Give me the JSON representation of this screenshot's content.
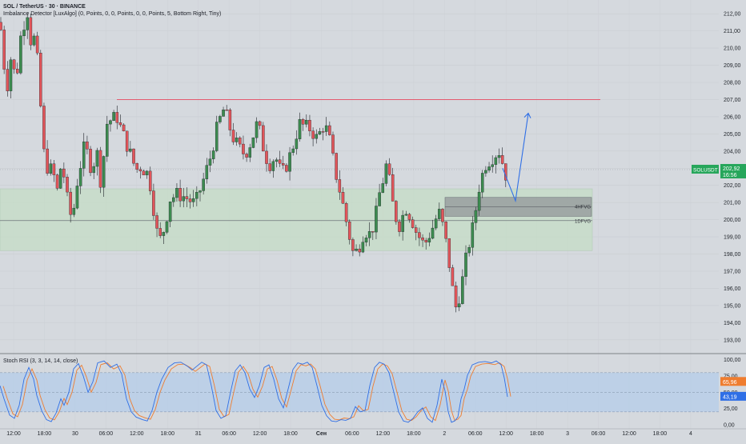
{
  "header": {
    "title": "SOL / TetherUS · 30 · BINANCE",
    "indicator": "Imbalance Detector [LuxAlgo] (0, Points, 0, 0, Points, 0, 0, Points, 5, Bottom Right, Tiny)"
  },
  "stoch_header": "Stoch RSI (3, 3, 14, 14, close)",
  "colors": {
    "background": "#d5d9de",
    "up": "#2f8f4e",
    "down": "#e0474c",
    "resistance": "#e45a6e",
    "zone_fill": "#c4dcc6",
    "fvg_fill": "#8e9296",
    "arrow": "#2f6fe6",
    "stoch_k": "#2f6fe6",
    "stoch_d": "#ef7d2f",
    "stoch_band": "#b6cde9",
    "price_tag": "#26a65b"
  },
  "chart_data": [
    {
      "type": "candlestick",
      "symbol": "SOLUSDT",
      "exchange": "BINANCE",
      "interval": "30",
      "ylim": [
        192.2,
        212.8
      ],
      "y_ticks": [
        "212,00",
        "211,00",
        "210,00",
        "209,00",
        "208,00",
        "207,00",
        "206,00",
        "205,00",
        "204,00",
        "203,00",
        "202,00",
        "201,00",
        "200,00",
        "199,00",
        "198,00",
        "197,00",
        "196,00",
        "195,00",
        "194,00",
        "193,00"
      ],
      "x_ticks": [
        "12:00",
        "18:00",
        "30",
        "06:00",
        "12:00",
        "18:00",
        "31",
        "06:00",
        "12:00",
        "18:00",
        "Сен",
        "06:00",
        "12:00",
        "18:00",
        "2",
        "06:00",
        "12:00",
        "18:00",
        "3",
        "06:00",
        "12:00",
        "18:00",
        "4"
      ],
      "ohlc_path": [
        [
          211.5,
          0
        ],
        [
          210.2,
          3
        ],
        [
          207.4,
          8
        ],
        [
          209.6,
          14
        ],
        [
          208.0,
          20
        ],
        [
          210.7,
          26
        ],
        [
          212.2,
          34
        ],
        [
          209.8,
          40
        ],
        [
          211.0,
          44
        ],
        [
          203.2,
          56
        ],
        [
          202.8,
          66
        ],
        [
          201.6,
          72
        ],
        [
          203.5,
          77
        ],
        [
          201.2,
          84
        ],
        [
          199.9,
          90
        ],
        [
          202.4,
          97
        ],
        [
          204.4,
          106
        ],
        [
          203.0,
          114
        ],
        [
          203.9,
          122
        ],
        [
          202.1,
          126
        ],
        [
          205.7,
          134
        ],
        [
          206.0,
          146
        ],
        [
          205.3,
          151
        ],
        [
          204.2,
          160
        ],
        [
          202.9,
          170
        ],
        [
          203.1,
          176
        ],
        [
          202.6,
          186
        ],
        [
          200.0,
          194
        ],
        [
          198.6,
          198
        ],
        [
          199.6,
          206
        ],
        [
          201.2,
          212
        ],
        [
          201.5,
          222
        ],
        [
          201.3,
          232
        ],
        [
          200.9,
          244
        ],
        [
          202.3,
          254
        ],
        [
          203.5,
          262
        ],
        [
          205.5,
          272
        ],
        [
          206.5,
          280
        ],
        [
          204.9,
          290
        ],
        [
          204.2,
          298
        ],
        [
          203.8,
          306
        ],
        [
          204.6,
          314
        ],
        [
          205.7,
          322
        ],
        [
          204.0,
          330
        ],
        [
          203.2,
          336
        ],
        [
          203.7,
          344
        ],
        [
          202.6,
          352
        ],
        [
          203.4,
          360
        ],
        [
          204.3,
          366
        ],
        [
          205.6,
          374
        ],
        [
          205.4,
          382
        ],
        [
          205.3,
          388
        ],
        [
          204.7,
          396
        ],
        [
          205.5,
          404
        ],
        [
          205.1,
          410
        ],
        [
          203.0,
          418
        ],
        [
          201.4,
          426
        ],
        [
          199.6,
          434
        ],
        [
          197.9,
          442
        ],
        [
          198.4,
          448
        ],
        [
          199.5,
          456
        ],
        [
          199.0,
          460
        ],
        [
          199.8,
          468
        ],
        [
          201.5,
          474
        ],
        [
          202.6,
          480
        ],
        [
          203.5,
          484
        ],
        [
          201.5,
          488
        ],
        [
          200.2,
          494
        ],
        [
          199.6,
          500
        ],
        [
          200.8,
          506
        ],
        [
          200.1,
          514
        ],
        [
          199.3,
          520
        ],
        [
          198.5,
          530
        ],
        [
          199.1,
          536
        ],
        [
          199.7,
          542
        ],
        [
          200.5,
          548
        ],
        [
          199.5,
          554
        ],
        [
          197.9,
          560
        ],
        [
          196.3,
          564
        ],
        [
          194.8,
          570
        ],
        [
          196.0,
          576
        ],
        [
          198.2,
          584
        ],
        [
          199.8,
          592
        ],
        [
          201.8,
          598
        ],
        [
          203.2,
          606
        ],
        [
          203.5,
          612
        ],
        [
          203.8,
          618
        ],
        [
          204.0,
          624
        ],
        [
          202.6,
          632
        ]
      ],
      "last_price": "202,92",
      "countdown": "16:56",
      "resistance_level": 207.0,
      "demand_zone": [
        198.2,
        201.8
      ],
      "dfvg_level": 199.95,
      "dfvg_label": "1DFVG",
      "hfvg_zone": [
        200.2,
        201.3
      ],
      "hfvg_label": "4HFVG",
      "arrow": [
        [
          203.0,
          202.8
        ],
        [
          201.1,
          201.0
        ],
        [
          206.2,
          206.1
        ]
      ]
    },
    {
      "type": "line",
      "name": "Stoch RSI",
      "ylim": [
        -6,
        108
      ],
      "y_ticks": [
        "100,00",
        "75,00",
        "50,00",
        "25,00",
        "0,00"
      ],
      "band": [
        20,
        80
      ],
      "k_value": "43,19",
      "d_value": "65,96",
      "k_path": [
        [
          60,
          0
        ],
        [
          40,
          5
        ],
        [
          15,
          12
        ],
        [
          10,
          18
        ],
        [
          30,
          24
        ],
        [
          70,
          30
        ],
        [
          88,
          36
        ],
        [
          70,
          42
        ],
        [
          45,
          46
        ],
        [
          22,
          52
        ],
        [
          8,
          58
        ],
        [
          5,
          64
        ],
        [
          18,
          70
        ],
        [
          40,
          76
        ],
        [
          30,
          80
        ],
        [
          50,
          86
        ],
        [
          86,
          92
        ],
        [
          94,
          98
        ],
        [
          75,
          104
        ],
        [
          50,
          110
        ],
        [
          66,
          116
        ],
        [
          95,
          122
        ],
        [
          98,
          130
        ],
        [
          88,
          138
        ],
        [
          93,
          146
        ],
        [
          78,
          152
        ],
        [
          40,
          158
        ],
        [
          20,
          164
        ],
        [
          12,
          170
        ],
        [
          8,
          178
        ],
        [
          6,
          184
        ],
        [
          22,
          190
        ],
        [
          50,
          196
        ],
        [
          70,
          202
        ],
        [
          88,
          210
        ],
        [
          95,
          218
        ],
        [
          96,
          226
        ],
        [
          90,
          234
        ],
        [
          84,
          240
        ],
        [
          90,
          246
        ],
        [
          96,
          252
        ],
        [
          92,
          258
        ],
        [
          60,
          264
        ],
        [
          22,
          270
        ],
        [
          10,
          276
        ],
        [
          14,
          282
        ],
        [
          50,
          288
        ],
        [
          83,
          294
        ],
        [
          92,
          300
        ],
        [
          80,
          306
        ],
        [
          55,
          312
        ],
        [
          42,
          318
        ],
        [
          60,
          324
        ],
        [
          88,
          330
        ],
        [
          92,
          336
        ],
        [
          70,
          342
        ],
        [
          40,
          348
        ],
        [
          26,
          354
        ],
        [
          55,
          360
        ],
        [
          85,
          366
        ],
        [
          95,
          372
        ],
        [
          93,
          378
        ],
        [
          96,
          384
        ],
        [
          88,
          390
        ],
        [
          60,
          396
        ],
        [
          30,
          402
        ],
        [
          14,
          408
        ],
        [
          6,
          414
        ],
        [
          5,
          420
        ],
        [
          8,
          426
        ],
        [
          7,
          432
        ],
        [
          10,
          438
        ],
        [
          28,
          444
        ],
        [
          20,
          450
        ],
        [
          22,
          456
        ],
        [
          60,
          462
        ],
        [
          88,
          468
        ],
        [
          96,
          474
        ],
        [
          93,
          480
        ],
        [
          80,
          486
        ],
        [
          50,
          492
        ],
        [
          20,
          498
        ],
        [
          6,
          504
        ],
        [
          4,
          510
        ],
        [
          10,
          516
        ],
        [
          20,
          522
        ],
        [
          26,
          528
        ],
        [
          10,
          534
        ],
        [
          4,
          540
        ],
        [
          30,
          546
        ],
        [
          70,
          552
        ],
        [
          52,
          556
        ],
        [
          20,
          560
        ],
        [
          4,
          564
        ],
        [
          6,
          568
        ],
        [
          12,
          572
        ],
        [
          40,
          576
        ],
        [
          55,
          580
        ],
        [
          76,
          584
        ],
        [
          92,
          590
        ],
        [
          96,
          598
        ],
        [
          97,
          606
        ],
        [
          95,
          614
        ],
        [
          98,
          620
        ],
        [
          92,
          626
        ],
        [
          72,
          630
        ],
        [
          43,
          634
        ]
      ],
      "d_shift": 4
    }
  ]
}
